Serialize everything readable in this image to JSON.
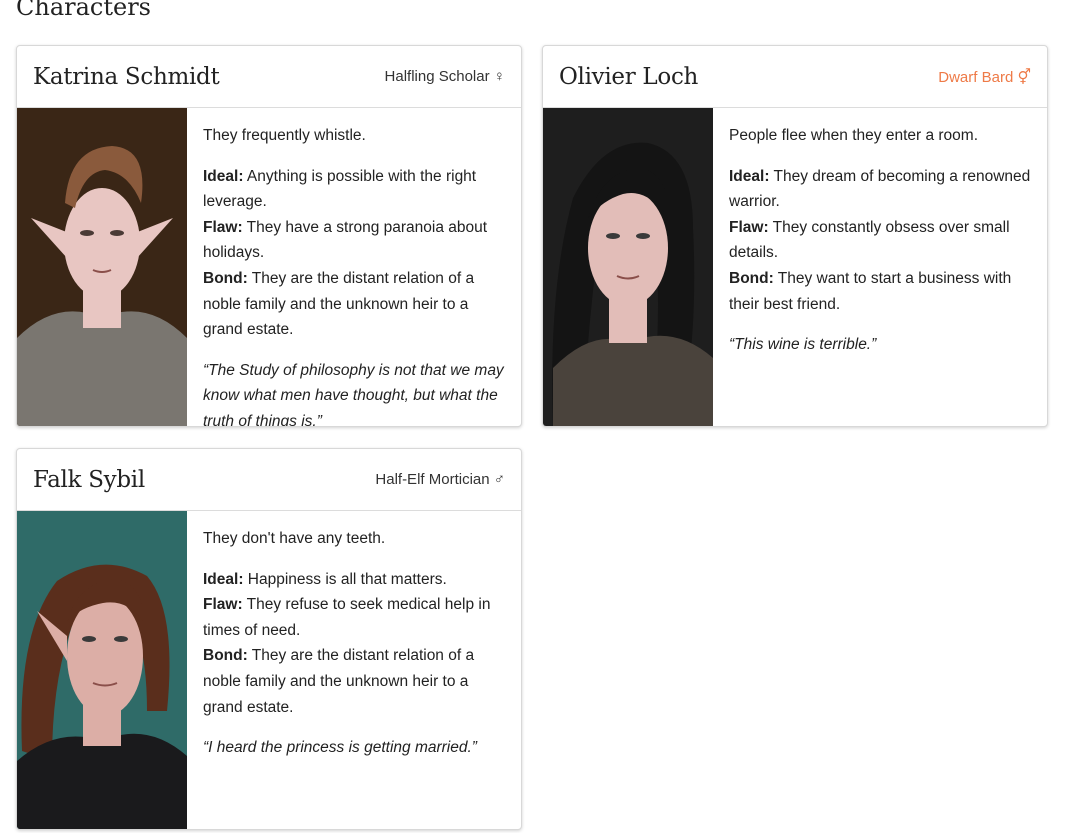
{
  "page": {
    "title": "Characters"
  },
  "characters": [
    {
      "name": "Katrina Schmidt",
      "class": "Halfling Scholar ♀",
      "class_color": "#333333",
      "trait": "They frequently whistle.",
      "ideal_label": "Ideal:",
      "ideal": " Anything is possible with the right leverage.",
      "flaw_label": "Flaw:",
      "flaw": " They have a strong paranoia about holidays.",
      "bond_label": "Bond:",
      "bond": " They are the distant relation of a noble family and the unknown heir to a grand estate.",
      "quote": "“The Study of philosophy is not that we may know what men have thought, but what the truth of things is.”",
      "portrait": {
        "background": "#3a2616",
        "hair": "#8a5a3c",
        "skin": "#e8c6c2",
        "clothing": "#7a7670"
      }
    },
    {
      "name": "Olivier Loch",
      "class": "Dwarf Bard ⚥",
      "class_color": "#ee7a47",
      "trait": "People flee when they enter a room.",
      "ideal_label": "Ideal:",
      "ideal": " They dream of becoming a renowned warrior.",
      "flaw_label": "Flaw:",
      "flaw": " They constantly obsess over small details.",
      "bond_label": "Bond:",
      "bond": " They want to start a business with their best friend.",
      "quote": "“This wine is terrible.”",
      "portrait": {
        "background": "#1e1e1e",
        "hair": "#141414",
        "skin": "#e2bdb8",
        "clothing": "#4a433c"
      }
    },
    {
      "name": "Falk Sybil",
      "class": "Half-Elf Mortician ♂",
      "class_color": "#333333",
      "trait": "They don't have any teeth.",
      "ideal_label": "Ideal:",
      "ideal": " Happiness is all that matters.",
      "flaw_label": "Flaw:",
      "flaw": " They refuse to seek medical help in times of need.",
      "bond_label": "Bond:",
      "bond": " They are the distant relation of a noble family and the unknown heir to a grand estate.",
      "quote": "“I heard the princess is getting married.”",
      "portrait": {
        "background": "#2f6b68",
        "hair": "#5a2e1c",
        "skin": "#dcaea6",
        "clothing": "#1a1a1c"
      }
    }
  ]
}
